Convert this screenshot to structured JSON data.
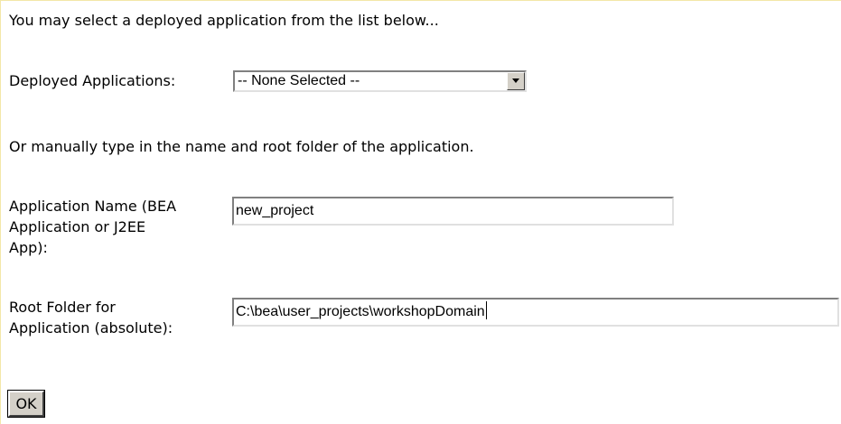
{
  "intro_text": "You may select a deployed application from the list below...",
  "deployed": {
    "label": "Deployed Applications:",
    "selected": "-- None Selected --"
  },
  "manual_text": "Or manually type in the name and root folder of the application.",
  "app_name": {
    "label_line1": "Application Name (BEA",
    "label_line2": "Application or J2EE",
    "label_line3": "App):",
    "value": "new_project"
  },
  "root_folder": {
    "label_line1": "Root Folder for",
    "label_line2": "Application (absolute):",
    "value": "C:\\bea\\user_projects\\workshopDomain"
  },
  "ok_label": "OK"
}
